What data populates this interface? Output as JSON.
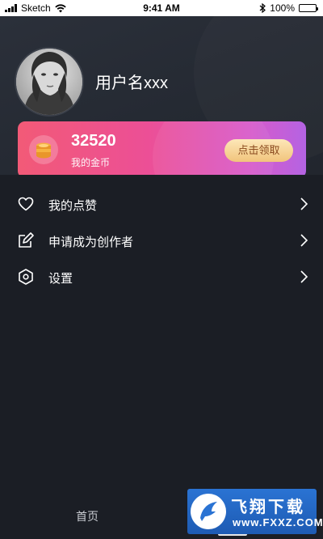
{
  "status_bar": {
    "carrier": "Sketch",
    "time": "9:41 AM",
    "battery": "100%",
    "battery_level": 1.0,
    "icons": [
      "signal-bars-icon",
      "wifi-icon",
      "bluetooth-icon",
      "battery-icon"
    ]
  },
  "profile": {
    "username": "用户名xxx",
    "avatar": "avatar-photo"
  },
  "coins": {
    "value": "32520",
    "label": "我的金币",
    "claim_label": "点击领取",
    "icon": "coin-stack-icon"
  },
  "menu": {
    "items": [
      {
        "label": "我的点赞",
        "icon": "heart-icon"
      },
      {
        "label": "申请成为创作者",
        "icon": "edit-icon"
      },
      {
        "label": "设置",
        "icon": "settings-hexagon-icon"
      }
    ]
  },
  "tabbar": {
    "home_label": "首页"
  },
  "watermark": {
    "title": "飞翔下载",
    "subtitle": "www.FXXZ.COM"
  },
  "colors": {
    "background": "#1b1e25",
    "header": "#272b34",
    "card_gradient_start": "#f25a77",
    "card_gradient_end": "#b463e3",
    "claim_button": "#f4cf8c",
    "claim_text": "#8a4b1f",
    "watermark_blue": "#2a73d3"
  }
}
